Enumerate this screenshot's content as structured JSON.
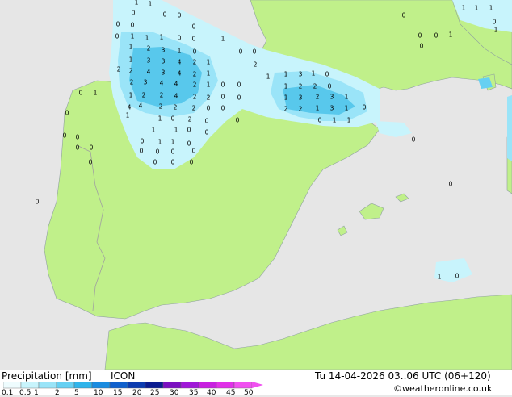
{
  "title": "Precipitation [mm]",
  "model": "ICON",
  "datetime": "Tu 14-04-2026 03..06 UTC (06+120)",
  "credit": "©weatheronline.co.uk",
  "colors": {
    "sea": "#e6e6e6",
    "land": "#c0f08a",
    "border": "#a0a0a0",
    "precip_light": "#c8f4fc",
    "precip_mid": "#9ae4f8",
    "precip_heavy": "#58c8ec"
  },
  "legend": {
    "labels": [
      "0.1",
      "0.5",
      "1",
      "2",
      "5",
      "10",
      "15",
      "20",
      "25",
      "30",
      "35",
      "40",
      "45",
      "50"
    ],
    "colors": [
      "#eefcfe",
      "#c8f4fc",
      "#9ae4f8",
      "#66d0f2",
      "#30b4ea",
      "#1a8ce0",
      "#1060cc",
      "#0c3cb0",
      "#0a1c90",
      "#7a10c0",
      "#a018d8",
      "#c820e0",
      "#e030e8",
      "#f050f0"
    ]
  },
  "map_values": [
    {
      "v": "1"
    },
    {
      "v": "1"
    },
    {
      "v": "0"
    },
    {
      "v": "0"
    },
    {
      "v": "0"
    },
    {
      "v": "0"
    },
    {
      "v": "0"
    },
    {
      "v": "0"
    },
    {
      "v": "0"
    },
    {
      "v": "1"
    },
    {
      "v": "1"
    },
    {
      "v": "1"
    },
    {
      "v": "0"
    },
    {
      "v": "0"
    },
    {
      "v": "1"
    },
    {
      "v": "1"
    },
    {
      "v": "2"
    },
    {
      "v": "3"
    },
    {
      "v": "1"
    },
    {
      "v": "0"
    },
    {
      "v": "1"
    },
    {
      "v": "3"
    },
    {
      "v": "3"
    },
    {
      "v": "4"
    },
    {
      "v": "2"
    },
    {
      "v": "1"
    },
    {
      "v": "2"
    },
    {
      "v": "2"
    },
    {
      "v": "4"
    },
    {
      "v": "3"
    },
    {
      "v": "4"
    },
    {
      "v": "2"
    },
    {
      "v": "1"
    },
    {
      "v": "2"
    },
    {
      "v": "3"
    },
    {
      "v": "4"
    },
    {
      "v": "4"
    },
    {
      "v": "2"
    },
    {
      "v": "1"
    },
    {
      "v": "0"
    },
    {
      "v": "0"
    },
    {
      "v": "1"
    },
    {
      "v": "2"
    },
    {
      "v": "2"
    },
    {
      "v": "4"
    },
    {
      "v": "2"
    },
    {
      "v": "2"
    },
    {
      "v": "0"
    },
    {
      "v": "0"
    },
    {
      "v": "0"
    },
    {
      "v": "4"
    },
    {
      "v": "4"
    },
    {
      "v": "2"
    },
    {
      "v": "2"
    },
    {
      "v": "2"
    },
    {
      "v": "0"
    },
    {
      "v": "0"
    },
    {
      "v": "1"
    },
    {
      "v": "1"
    },
    {
      "v": "0"
    },
    {
      "v": "2"
    },
    {
      "v": "0"
    },
    {
      "v": "0"
    },
    {
      "v": "1"
    },
    {
      "v": "1"
    },
    {
      "v": "0"
    },
    {
      "v": "0"
    },
    {
      "v": "0"
    },
    {
      "v": "1"
    },
    {
      "v": "1"
    },
    {
      "v": "0"
    },
    {
      "v": "0"
    },
    {
      "v": "0"
    },
    {
      "v": "0"
    },
    {
      "v": "0"
    },
    {
      "v": "0"
    },
    {
      "v": "0"
    },
    {
      "v": "0"
    },
    {
      "v": "0"
    },
    {
      "v": "1"
    },
    {
      "v": "0"
    },
    {
      "v": "0"
    },
    {
      "v": "0"
    },
    {
      "v": "0"
    },
    {
      "v": "0"
    },
    {
      "v": "0"
    },
    {
      "v": "0"
    },
    {
      "v": "0"
    },
    {
      "v": "2"
    },
    {
      "v": "1"
    },
    {
      "v": "1"
    },
    {
      "v": "3"
    },
    {
      "v": "1"
    },
    {
      "v": "0"
    },
    {
      "v": "1"
    },
    {
      "v": "2"
    },
    {
      "v": "2"
    },
    {
      "v": "0"
    },
    {
      "v": "1"
    },
    {
      "v": "3"
    },
    {
      "v": "2"
    },
    {
      "v": "3"
    },
    {
      "v": "1"
    },
    {
      "v": "2"
    },
    {
      "v": "2"
    },
    {
      "v": "1"
    },
    {
      "v": "3"
    },
    {
      "v": "1"
    },
    {
      "v": "0"
    },
    {
      "v": "0"
    },
    {
      "v": "1"
    },
    {
      "v": "1"
    },
    {
      "v": "0"
    },
    {
      "v": "0"
    },
    {
      "v": "0"
    },
    {
      "v": "0"
    },
    {
      "v": "1"
    },
    {
      "v": "1"
    },
    {
      "v": "1"
    },
    {
      "v": "1"
    },
    {
      "v": "1"
    },
    {
      "v": "0"
    },
    {
      "v": "1"
    },
    {
      "v": "0"
    },
    {
      "v": "0"
    },
    {
      "v": "0"
    }
  ]
}
